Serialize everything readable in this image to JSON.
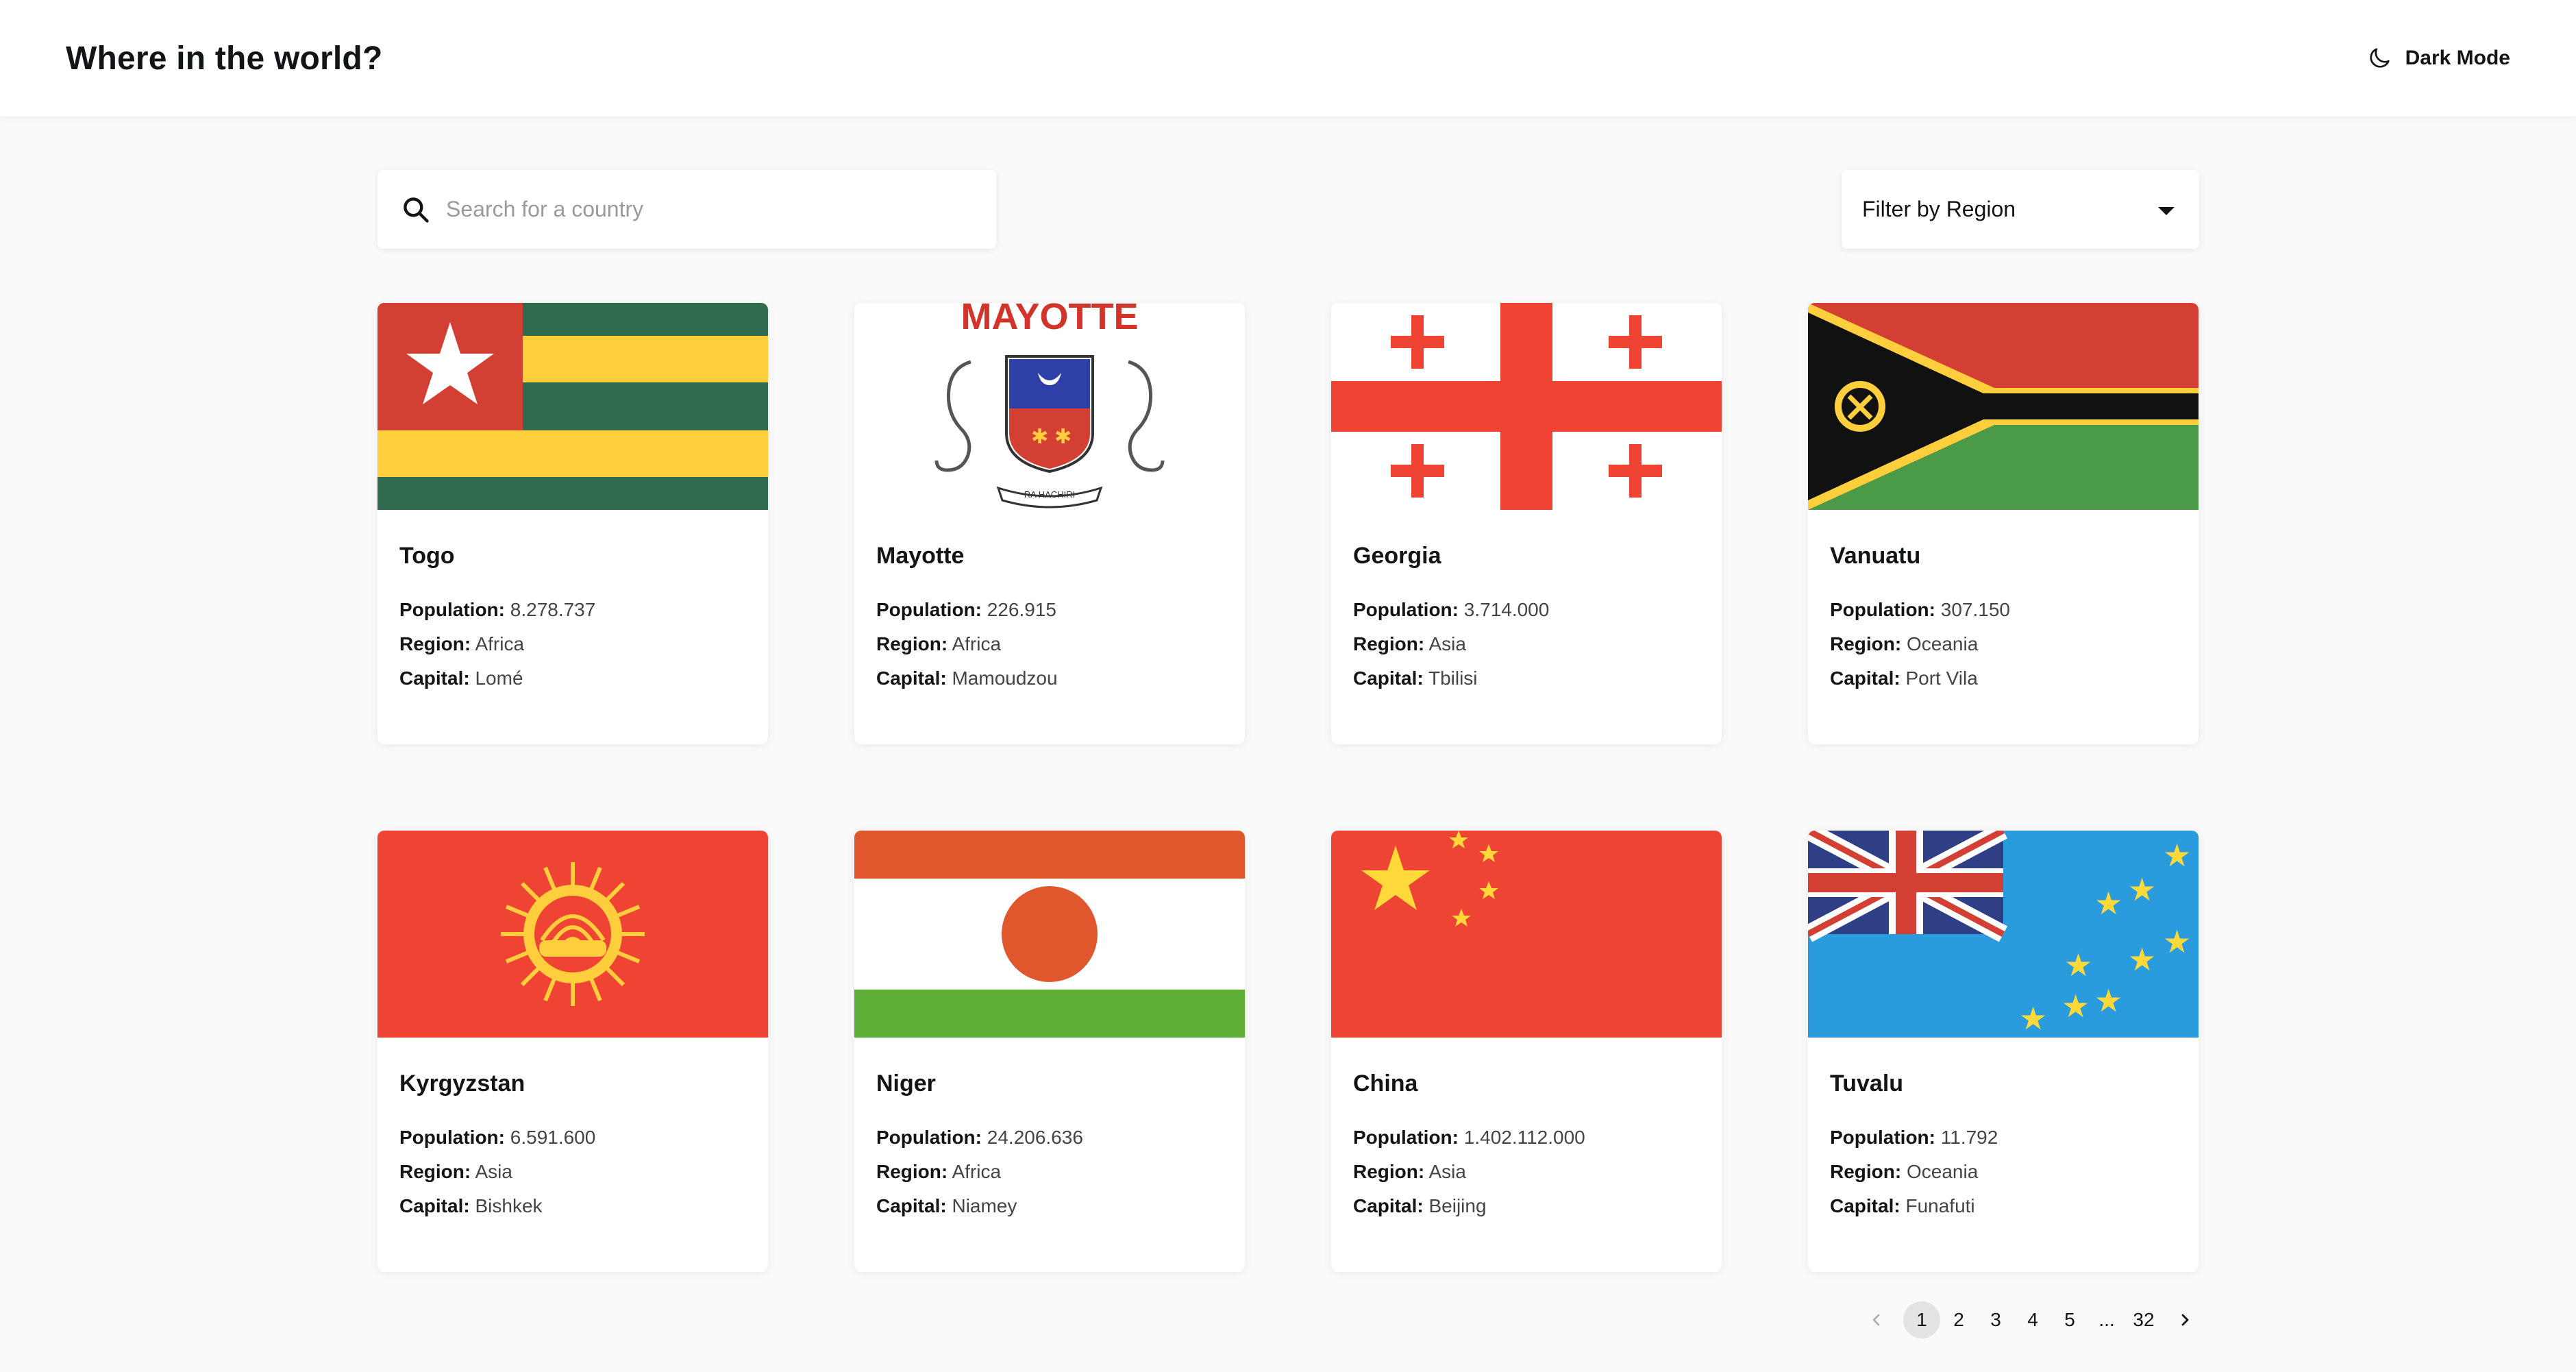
{
  "header": {
    "title": "Where in the world?",
    "theme_toggle_label": "Dark Mode",
    "theme_icon": "moon-icon"
  },
  "search": {
    "placeholder": "Search for a country",
    "value": "",
    "icon": "search-icon"
  },
  "filter": {
    "label": "Filter by Region",
    "icon": "caret-down-icon"
  },
  "labels": {
    "population": "Population:",
    "region": "Region:",
    "capital": "Capital:"
  },
  "countries": [
    {
      "name": "Togo",
      "population": "8.278.737",
      "region": "Africa",
      "capital": "Lomé"
    },
    {
      "name": "Mayotte",
      "population": "226.915",
      "region": "Africa",
      "capital": "Mamoudzou",
      "flag_text": "MAYOTTE",
      "flag_motto": "RA HACHIRI"
    },
    {
      "name": "Georgia",
      "population": "3.714.000",
      "region": "Asia",
      "capital": "Tbilisi"
    },
    {
      "name": "Vanuatu",
      "population": "307.150",
      "region": "Oceania",
      "capital": "Port Vila"
    },
    {
      "name": "Kyrgyzstan",
      "population": "6.591.600",
      "region": "Asia",
      "capital": "Bishkek"
    },
    {
      "name": "Niger",
      "population": "24.206.636",
      "region": "Africa",
      "capital": "Niamey"
    },
    {
      "name": "China",
      "population": "1.402.112.000",
      "region": "Asia",
      "capital": "Beijing"
    },
    {
      "name": "Tuvalu",
      "population": "11.792",
      "region": "Oceania",
      "capital": "Funafuti"
    }
  ],
  "pagination": {
    "pages": [
      "1",
      "2",
      "3",
      "4",
      "5"
    ],
    "ellipsis": "...",
    "last": "32",
    "current": "1",
    "prev_icon": "chevron-left-icon",
    "next_icon": "chevron-right-icon"
  },
  "colors": {
    "background": "#fafafa",
    "surface": "#ffffff",
    "text": "#111517"
  }
}
